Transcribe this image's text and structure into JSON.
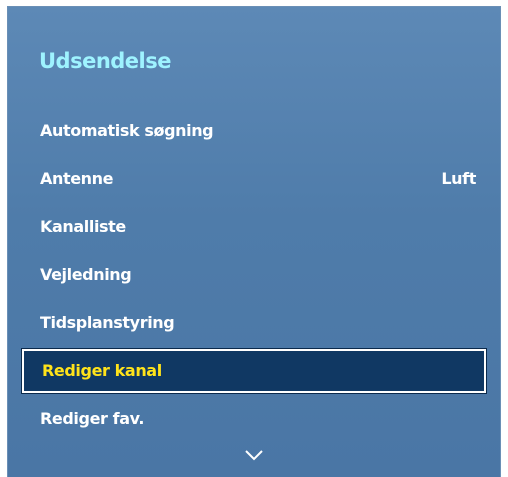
{
  "menu": {
    "title": "Udsendelse",
    "items": [
      {
        "label": "Automatisk søgning",
        "value": ""
      },
      {
        "label": "Antenne",
        "value": "Luft"
      },
      {
        "label": "Kanalliste",
        "value": ""
      },
      {
        "label": "Vejledning",
        "value": ""
      },
      {
        "label": "Tidsplanstyring",
        "value": ""
      },
      {
        "label": "Rediger kanal",
        "value": "",
        "selected": true
      },
      {
        "label": "Rediger fav.",
        "value": ""
      }
    ],
    "scroll_icon": "chevron-down-icon"
  },
  "colors": {
    "title": "#9ef3ff",
    "selected_text": "#ffe31a",
    "selected_background": "#103863",
    "panel_background": "#5683b0"
  }
}
